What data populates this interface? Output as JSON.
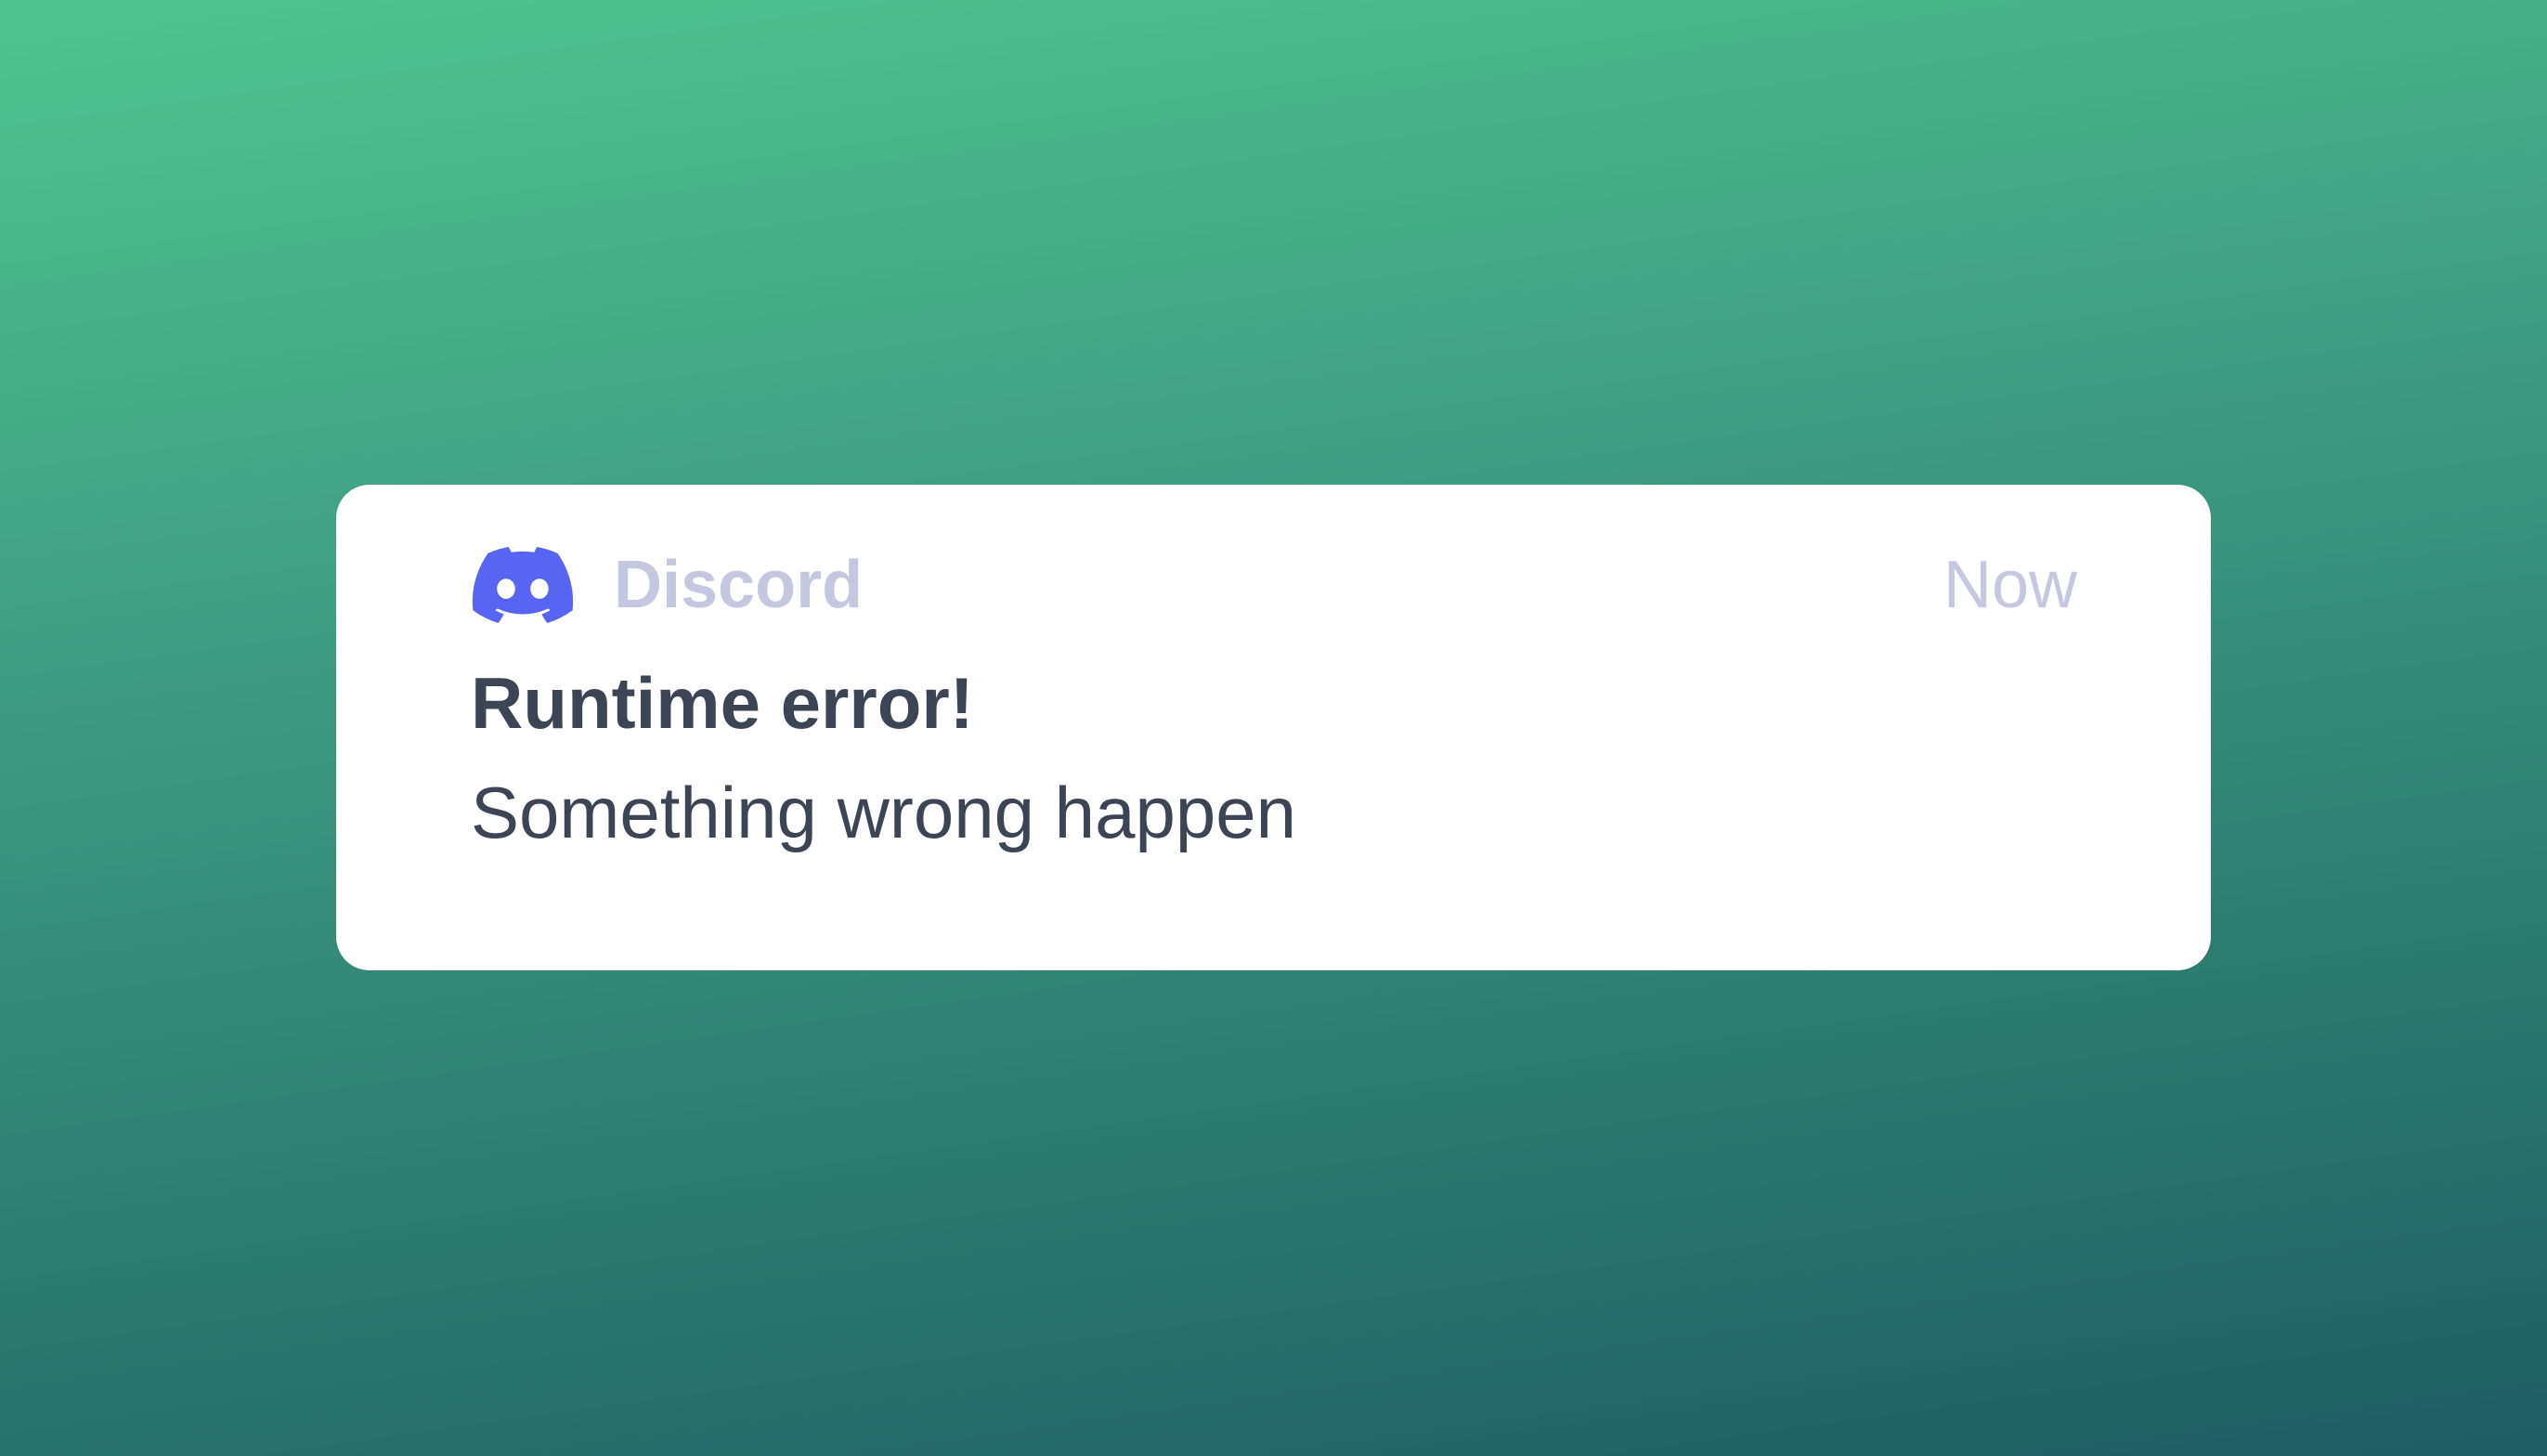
{
  "notification": {
    "app_icon": "discord-logo-icon",
    "app_name": "Discord",
    "time": "Now",
    "title": "Runtime error!",
    "message": "Something wrong happen"
  },
  "colors": {
    "background_top": "#4fc490",
    "background_bottom": "#1f5d63",
    "card": "#ffffff",
    "brand": "#5865f2",
    "muted_text": "#c4c7e0",
    "text": "#3b4555"
  }
}
